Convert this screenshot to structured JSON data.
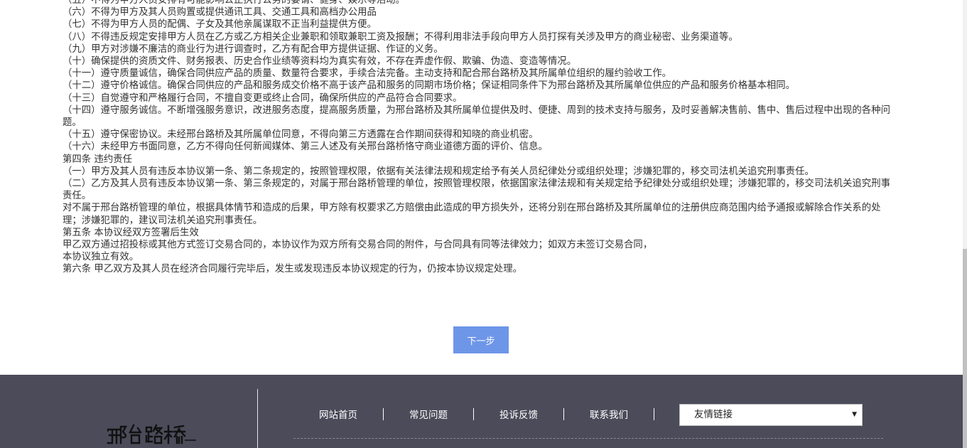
{
  "lines": [
    "（五）不得为甲方人员安排有可能影响公正执行公务的宴请、健身、娱乐等活动。",
    "（六）不得为甲方及其人员购置或提供通讯工具、交通工具和高档办公用品",
    "（七）不得为甲方人员的配偶、子女及其他亲属谋取不正当利益提供方便。",
    "（八）不得违反规定安排甲方人员在乙方或乙方相关企业兼职和领取兼职工资及报酬；不得利用非法手段向甲方人员打探有关涉及甲方的商业秘密、业务渠道等。",
    "（九）甲方对涉嫌不廉洁的商业行为进行调查时，乙方有配合甲方提供证据、作证的义务。",
    "（十）确保提供的资质文件、财务报表、历史合作业绩等资料均为真实有效，不存在弄虚作假、欺骗、伪造、变造等情况。",
    "（十一）遵守质量诚信，确保合同供应产品的质量、数量符合要求，手续合法完备。主动支持和配合邢台路桥及其所属单位组织的履约验收工作。",
    "（十二）遵守价格诚信。确保合同供应的产品和服务成交价格不高于该产品和服务的同期市场价格；保证相同条件下为邢台路桥及其所属单位供应的产品和服务价格基本相同。",
    "（十三）自觉遵守和严格履行合同，不擅自变更或终止合同，确保所供应的产品符合合同要求。",
    "（十四）遵守服务诚信。不断增强服务意识，改进服务态度，提高服务质量，为邢台路桥及其所属单位提供及时、便捷、周到的技术支持与服务，及时妥善解决售前、售中、售后过程中出现的各种问题。",
    "（十五）遵守保密协议。未经邢台路桥及其所属单位同意，不得向第三方透露在合作期间获得和知晓的商业机密。",
    "（十六）未经甲方书面同意，乙方不得向任何新闻媒体、第三人述及有关邢台路桥恪守商业道德方面的评价、信息。",
    "第四条 违约责任",
    "（一）甲方及其人员有违反本协议第一条、第二条规定的，按照管理权限，依据有关法律法规和规定给予有关人员纪律处分或组织处理；涉嫌犯罪的，移交司法机关追究刑事责任。",
    "（二）乙方及其人员有违反本协议第一条、第三条规定的，对属于邢台路桥管理的单位，按照管理权限，依据国家法律法规和有关规定给予纪律处分或组织处理；涉嫌犯罪的，移交司法机关追究刑事责任。",
    "对不属于邢台路桥管理的单位，根据具体情节和造成的后果，甲方除有权要求乙方赔偿由此造成的甲方损失外，还将分别在邢台路桥及其所属单位的注册供应商范围内给予通报或解除合作关系的处理；涉嫌犯罪的，建议司法机关追究刑事责任。",
    "第五条 本协议经双方签署后生效",
    "甲乙双方通过招投标或其他方式签订交易合同的，本协议作为双方所有交易合同的附件，与合同具有同等法律效力；如双方未签订交易合同，",
    "本协议独立有效。",
    "第六条 甲乙双方及其人员在经济合同履行完毕后，发生或发现违反本协议规定的行为，仍按本协议规定处理。"
  ],
  "next_button": "下一步",
  "footer": {
    "logo_text": "邢台路桥",
    "nav": [
      "网站首页",
      "常见问题",
      "投诉反馈",
      "联系我们"
    ],
    "links_select": "友情链接"
  },
  "colors": {
    "button": "#6e96e8",
    "footer_bg": "#4b4b5a"
  }
}
